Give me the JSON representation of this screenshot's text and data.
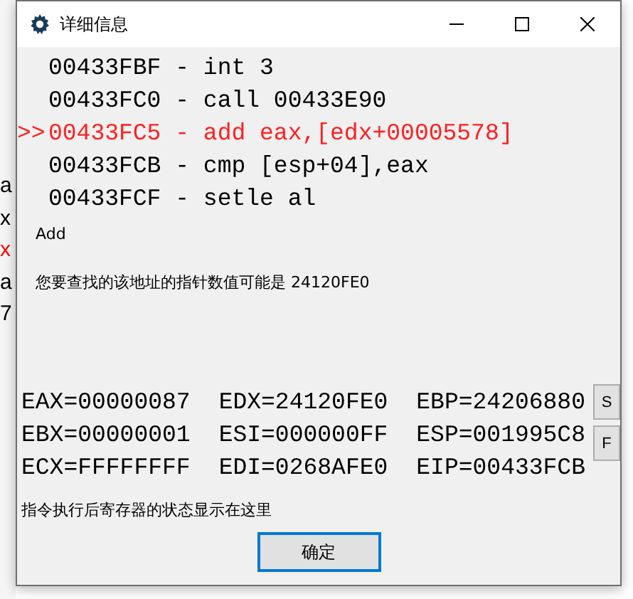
{
  "background_fragments": [
    {
      "text": "a",
      "color": "#000000"
    },
    {
      "text": "x",
      "color": "#000000"
    },
    {
      "text": "x",
      "color": "#ff0000"
    },
    {
      "text": "a",
      "color": "#000000"
    },
    {
      "text": "7",
      "color": "#000000"
    }
  ],
  "window": {
    "title": "详细信息"
  },
  "disassembly": [
    {
      "text": "00433FBF - int 3",
      "current": false
    },
    {
      "text": "00433FC0 - call 00433E90",
      "current": false
    },
    {
      "marker": ">>",
      "text": "00433FC5 - add eax,[edx+00005578]",
      "current": true
    },
    {
      "text": "00433FCB - cmp [esp+04],eax",
      "current": false
    },
    {
      "text": "00433FCF - setle al",
      "current": false
    }
  ],
  "mnemonic": "Add",
  "pointer_hint": "您要查找的该地址的指针数值可能是 24120FE0",
  "registers": [
    [
      "EAX=00000087",
      "EDX=24120FE0",
      "EBP=24206880"
    ],
    [
      "EBX=00000001",
      "ESI=000000FF",
      "ESP=001995C8"
    ],
    [
      "ECX=FFFFFFFF",
      "EDI=0268AFE0",
      "EIP=00433FCB"
    ]
  ],
  "side_buttons": [
    "S",
    "F"
  ],
  "status_text": "指令执行后寄存器的状态显示在这里",
  "ok_button": "确定"
}
